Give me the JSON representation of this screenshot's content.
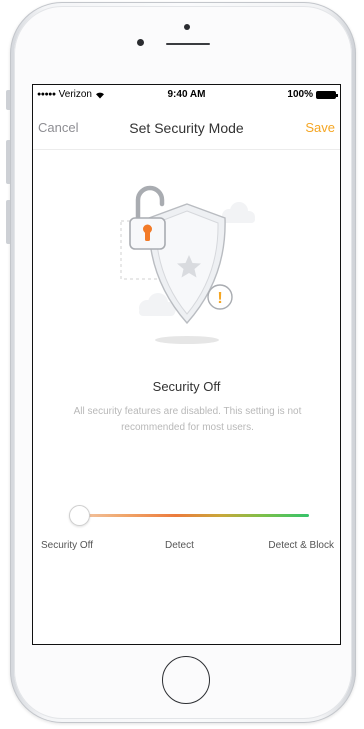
{
  "status_bar": {
    "signal": "●●●●●",
    "carrier": "Verizon",
    "time": "9:40 AM",
    "battery": "100%"
  },
  "nav": {
    "cancel_label": "Cancel",
    "title": "Set Security Mode",
    "save_label": "Save"
  },
  "mode": {
    "title": "Security Off",
    "description": "All security features are disabled. This setting is not recommended for most users.",
    "warning_glyph": "!"
  },
  "slider": {
    "options": [
      "Security Off",
      "Detect",
      "Detect & Block"
    ],
    "selected_index": 0,
    "selected": "Security Off"
  },
  "icons": {
    "wifi": "wifi-icon",
    "battery": "battery-icon",
    "lock": "open-padlock-icon",
    "shield": "shield-icon",
    "star": "star-icon",
    "warning": "warning-icon",
    "cloud": "cloud-icon"
  },
  "colors": {
    "accent": "#f5a623",
    "lock_orange": "#f27a27",
    "warning_orange": "#f5a623",
    "muted_text": "#b8b8b8",
    "cancel_gray": "#8e8e93",
    "slider_start": "#f2c6a6",
    "slider_end": "#35c36a"
  }
}
